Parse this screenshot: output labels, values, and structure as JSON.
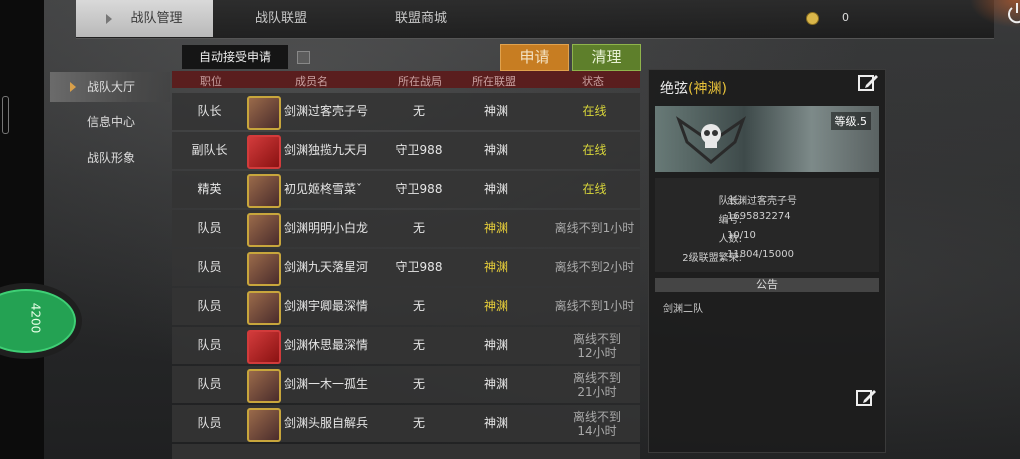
{
  "tabs": [
    {
      "label": "战队管理",
      "active": true
    },
    {
      "label": "战队联盟",
      "active": false
    },
    {
      "label": "联盟商城",
      "active": false
    }
  ],
  "currency": {
    "value": "0",
    "icon": "coin-icon"
  },
  "controls": {
    "auto_accept_label": "自动接受申请",
    "apply_label": "申请",
    "clear_label": "清理"
  },
  "submenu": [
    {
      "label": "战队大厅",
      "active": true
    },
    {
      "label": "信息中心",
      "active": false
    },
    {
      "label": "战队形象",
      "active": false
    }
  ],
  "table": {
    "headers": [
      "职位",
      "成员名",
      "所在战局",
      "所在联盟",
      "状态"
    ],
    "rows": [
      {
        "role": "队长",
        "name": "剑渊过客壳子号",
        "battle": "无",
        "alliance": "神渊",
        "status": "在线",
        "online": true
      },
      {
        "role": "副队长",
        "name": "剑渊独揽九天月",
        "battle": "守卫988",
        "alliance": "神渊",
        "status": "在线",
        "online": true
      },
      {
        "role": "精英",
        "name": "初见姬柊雪菜ˇ",
        "battle": "守卫988",
        "alliance": "神渊",
        "status": "在线",
        "online": true
      },
      {
        "role": "队员",
        "name": "剑渊明明小白龙",
        "battle": "无",
        "alliance": "神渊",
        "status": "离线不到1小时",
        "online": false
      },
      {
        "role": "队员",
        "name": "剑渊九天落星河",
        "battle": "守卫988",
        "alliance": "神渊",
        "status": "离线不到2小时",
        "online": false
      },
      {
        "role": "队员",
        "name": "剑渊宇卿最深情",
        "battle": "无",
        "alliance": "神渊",
        "status": "离线不到1小时",
        "online": false
      },
      {
        "role": "队员",
        "name": "剑渊休思最深情",
        "battle": "无",
        "alliance": "神渊",
        "status": "离线不到12小时",
        "online": false
      },
      {
        "role": "队员",
        "name": "剑渊一木一孤生",
        "battle": "无",
        "alliance": "神渊",
        "status": "离线不到21小时",
        "online": false
      },
      {
        "role": "队员",
        "name": "剑渊头服自解兵",
        "battle": "无",
        "alliance": "神渊",
        "status": "离线不到14小时",
        "online": false
      }
    ]
  },
  "team_panel": {
    "team_name": "绝弦",
    "alliance": "(神渊)",
    "level": "等级.5",
    "captain_key": "队长:",
    "captain": "剑渊过客壳子号",
    "id_key": "编号:",
    "id": "1695832274",
    "members_key": "人数:",
    "members": "10/10",
    "prosperity_key": "2级联盟繁荣:",
    "prosperity": "11804/15000",
    "notice_label": "公告",
    "notice": "剑渊二队"
  },
  "left_badge": "4200",
  "colors": {
    "online": "#d9d63a",
    "alliance_highlight": "#e8cf3a",
    "apply": "#c77d22",
    "clear": "#5e7f2b",
    "header": "#5a1e1e"
  }
}
